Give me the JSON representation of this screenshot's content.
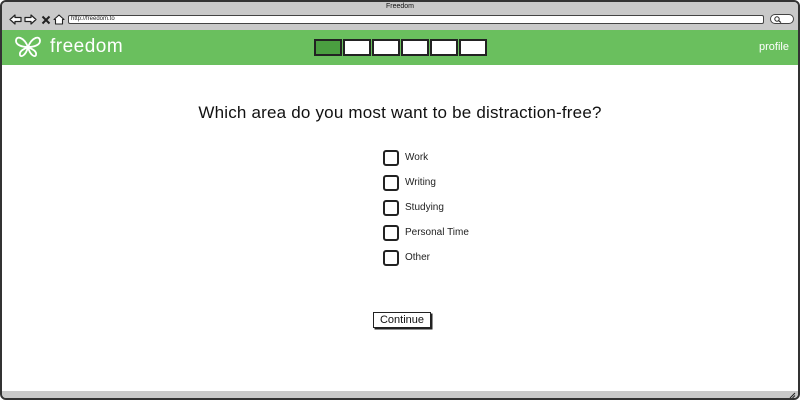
{
  "window": {
    "title": "Freedom"
  },
  "browser": {
    "url": "http://freedom.to",
    "buttons": {
      "back": "back-arrow-icon",
      "forward": "forward-arrow-icon",
      "stop": "close-icon",
      "home": "home-icon",
      "search": "search-icon"
    }
  },
  "header": {
    "app_name": "freedom",
    "logo_icon": "butterfly-icon",
    "profile_label": "profile",
    "progress": {
      "total_steps": 6,
      "completed_steps": 1
    },
    "colors": {
      "brand_green": "#6abf5e",
      "completed_step": "#4a9e40"
    }
  },
  "main": {
    "question": "Which area do you most want to be distraction-free?",
    "options": [
      {
        "label": "Work",
        "checked": false
      },
      {
        "label": "Writing",
        "checked": false
      },
      {
        "label": "Studying",
        "checked": false
      },
      {
        "label": "Personal Time",
        "checked": false
      },
      {
        "label": "Other",
        "checked": false
      }
    ],
    "continue_label": "Continue"
  }
}
